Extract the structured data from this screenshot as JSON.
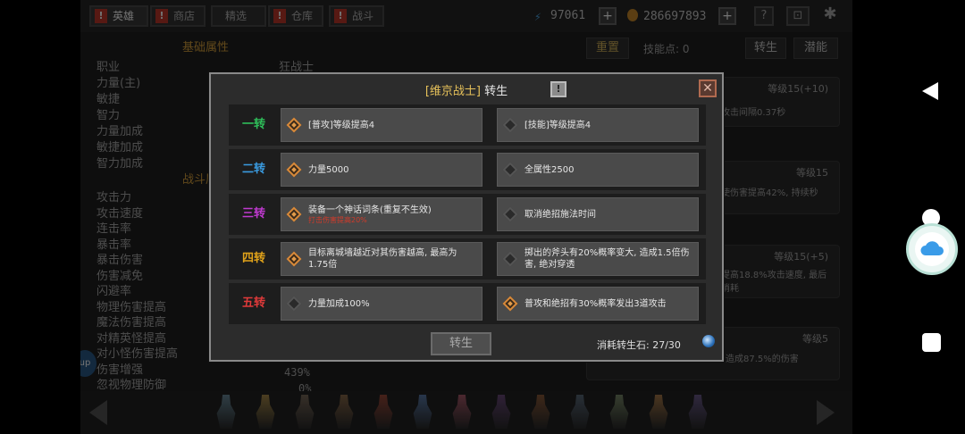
{
  "topbar": {
    "tabs": [
      {
        "label": "英雄",
        "badge": "!"
      },
      {
        "label": "商店",
        "badge": "!"
      },
      {
        "label": "精选",
        "badge": ""
      },
      {
        "label": "仓库",
        "badge": "!"
      },
      {
        "label": "战斗",
        "badge": "!"
      }
    ],
    "energy": "97061",
    "gold": "286697893",
    "plus": "+",
    "help": "?",
    "gamepad": "⊡",
    "settings": "✱"
  },
  "left_panel": {
    "section1_title": "基础属性",
    "class_label": "职业",
    "class_value": "狂战士",
    "attrs1": [
      "力量(主)",
      "敏捷",
      "智力",
      "力量加成",
      "敏捷加成",
      "智力加成"
    ],
    "section2_title": "战斗属性",
    "attrs2": [
      "攻击力",
      "攻击速度",
      "连击率",
      "暴击率",
      "暴击伤害",
      "伤害减免",
      "闪避率",
      "物理伤害提高",
      "魔法伤害提高",
      "对精英怪提高",
      "对小怪伤害提高",
      "伤害增强",
      "忽视物理防御"
    ],
    "vals": [
      "439%",
      "0%"
    ],
    "side_badge": "up"
  },
  "right_panel": {
    "reset": "重置",
    "skill_points": "技能点: 0",
    "rebirth": "转生",
    "potential": "潜能",
    "cards": [
      {
        "level": "等级15(+10)",
        "desc": "攻击间隔0.37秒"
      },
      {
        "level": "等级15",
        "desc": "使伤害提高42%, 持续秒"
      },
      {
        "level": "等级15(+5)",
        "desc": "提高18.8%攻击速度, 最后消耗"
      },
      {
        "level": "等级5",
        "desc": "持续5秒, 攻击间隔0.1秒, 造成87.5%的伤害"
      }
    ]
  },
  "modal": {
    "title_hero": "[维京战士]",
    "title_suffix": "转生",
    "info": "!",
    "close": "✕",
    "rows": [
      {
        "tier": "一转",
        "color": "#2fbf5a",
        "left": {
          "text": "[普攻]等级提高4",
          "sub": "",
          "selected": true
        },
        "right": {
          "text": "[技能]等级提高4",
          "sub": "",
          "selected": false
        }
      },
      {
        "tier": "二转",
        "color": "#3a9be0",
        "left": {
          "text": "力量5000",
          "sub": "",
          "selected": true
        },
        "right": {
          "text": "全属性2500",
          "sub": "",
          "selected": false
        }
      },
      {
        "tier": "三转",
        "color": "#c03ad0",
        "left": {
          "text": "装备一个神话词条(重复不生效)",
          "sub": "打击伤害提高20%",
          "selected": true
        },
        "right": {
          "text": "取消绝招施法时间",
          "sub": "",
          "selected": false
        }
      },
      {
        "tier": "四转",
        "color": "#e0a21a",
        "left": {
          "text": "目标离城墙越近对其伤害越高, 最高为1.75倍",
          "sub": "",
          "selected": true
        },
        "right": {
          "text": "掷出的斧头有20%概率变大, 造成1.5倍伤害, 绝对穿透",
          "sub": "",
          "selected": false
        }
      },
      {
        "tier": "五转",
        "color": "#e03a3a",
        "left": {
          "text": "力量加成100%",
          "sub": "",
          "selected": false
        },
        "right": {
          "text": "普攻和绝招有30%概率发出3道攻击",
          "sub": "",
          "selected": true
        }
      }
    ],
    "button": "转生",
    "cost_label": "消耗转生石:",
    "cost_value": "27/30"
  },
  "colors": {
    "modal_bg": "#2c2c2c",
    "option_bg": "#4a4a4a",
    "accent_orange": "#d88a3a"
  }
}
